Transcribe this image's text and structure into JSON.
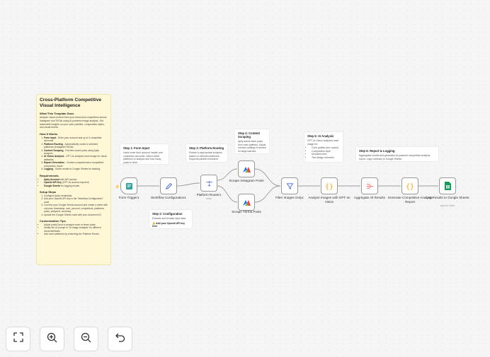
{
  "main_note": {
    "title": "Cross-Platform Competitive Visual Intelligence",
    "what_heading": "What This Template Does",
    "what_text": "Analyze visual content from your brand and competitors across Instagram and TikTok using AI-powered image analysis. Get actionable insights on your color palettes, composition styles, and visual trends.",
    "how_heading": "How It Works",
    "how_items": [
      {
        "bold": "Form Input",
        "text": " - Enter your account and up to 3 competitor accounts"
      },
      {
        "bold": "Platform Routing",
        "text": " - Automatically routes to selected platforms (Instagram/TikTok)"
      },
      {
        "bold": "Content Scraping",
        "text": " - Fetches recent posts using Apify scrapers"
      },
      {
        "bold": "AI Vision Analysis",
        "text": " - GPT-4o analyzes each image for visual attributes"
      },
      {
        "bold": "Report Generation",
        "text": " - Creates comprehensive competitive comparison report"
      },
      {
        "bold": "Logging",
        "text": " - Saves results to Google Sheets for tracking"
      }
    ],
    "req_heading": "Requirements",
    "req_items": [
      {
        "bold": "Apify Account",
        "text": " with API access"
      },
      {
        "bold": "OpenAI API Key",
        "text": " (GPT-4o access required)"
      },
      {
        "bold": "Google Sheets",
        "text": " for logging results"
      }
    ],
    "setup_heading": "Setup Steps",
    "setup_items": [
      "Configure Apify credentials",
      "Add your OpenAI API key in the \"Workflow Configuration\" node",
      "Connect your Google Sheets account and create a sheet with columns: timestamp, own_account, competitors, platforms, posts_analyzed, summary",
      "Update the Google Sheets node with your document ID"
    ],
    "tips_heading": "Customization Tips",
    "tips_items": [
      "Adjust postsCount to analyze more or fewer posts",
      "Modify the AI prompt in \"AI Image Analysis\" for different visual attributes",
      "Add more platforms by extending the Platform Router"
    ]
  },
  "notes": {
    "step1": {
      "title": "Step 1: Form Input",
      "text": "Users enter their account handle and competitor accounts. Select which platforms to analyze and how many posts to fetch."
    },
    "step2": {
      "title": "Step 2: Configuration",
      "text": "Extracts and formats input data.",
      "warn": "⚠️ Add your OpenAI API key here"
    },
    "step3": {
      "title": "Step 3: Platform Routing",
      "text": "Routes to appropriate scrapers based on selected platforms. Supports parallel execution."
    },
    "step4": {
      "title": "Step 4: Content Scraping",
      "text": "Apify actors fetch posts from each platform. Adjust memory settings if needed for large batches."
    },
    "step5": {
      "title": "Step 5: AI Analysis",
      "text": "GPT-4o Vision analyzes each image for:",
      "items": [
        "Color palette (hex codes)",
        "Composition style",
        "Mood/emotion",
        "Text design elements"
      ]
    },
    "step6": {
      "title": "Step 6: Report & Logging",
      "text": "Aggregates results and generates AI-powered competitive analysis report. Logs summary to Google Sheets."
    }
  },
  "nodes": {
    "form_trigger": "Form Trigger1",
    "workflow_config": "Workflow Configuration1",
    "platform_router": "Platform Router1",
    "platform_router_sub": "mode",
    "scrape_instagram": "Scrape Instagram Posts",
    "scrape_tiktok": "Scrape TikTok Posts",
    "filter_images": "Filter Images Only1",
    "analyze_images": "Analyze Images with GPT-4o Vision",
    "aggregate": "Aggregate All Results",
    "generate_report": "Generate Competitive Analysis Report",
    "log_results": "Log Results to Google Sheets",
    "log_results_sub": "append: sheet"
  },
  "colors": {
    "accent": "#ff6d5a",
    "sticky_main": "#fff7d6",
    "apify": "#1a73e8",
    "sheets": "#0f9d58",
    "code": "#ff9800"
  }
}
